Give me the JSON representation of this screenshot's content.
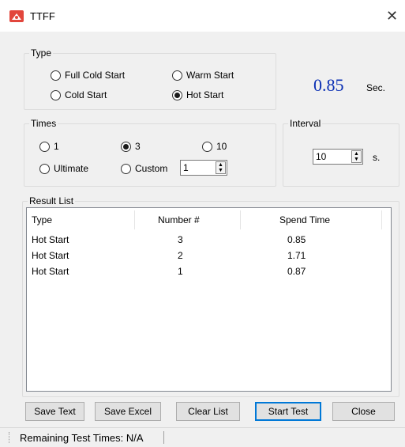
{
  "window": {
    "title": "TTFF",
    "close_glyph": "✕"
  },
  "type_group": {
    "label": "Type",
    "options": [
      "Full Cold Start",
      "Warm Start",
      "Cold Start",
      "Hot Start"
    ],
    "selected": "Hot Start"
  },
  "result_display": {
    "value": "0.85",
    "unit": "Sec.",
    "color": "#0a2fb4"
  },
  "times_group": {
    "label": "Times",
    "options": [
      "1",
      "3",
      "10",
      "Ultimate",
      "Custom"
    ],
    "selected": "3",
    "custom_value": "1"
  },
  "interval_group": {
    "label": "Interval",
    "value": "10",
    "unit": "s."
  },
  "result_list": {
    "label": "Result List",
    "columns": [
      "Type",
      "Number #",
      "Spend Time"
    ],
    "rows": [
      [
        "Hot Start",
        "3",
        "0.85"
      ],
      [
        "Hot Start",
        "2",
        "1.71"
      ],
      [
        "Hot Start",
        "1",
        "0.87"
      ]
    ]
  },
  "buttons": {
    "save_text": "Save Text",
    "save_excel": "Save Excel",
    "clear_list": "Clear List",
    "start_test": "Start Test",
    "close": "Close"
  },
  "status": {
    "text": "Remaining Test Times: N/A"
  },
  "icons": {
    "app": "ttff-app-icon",
    "close": "close-icon"
  }
}
